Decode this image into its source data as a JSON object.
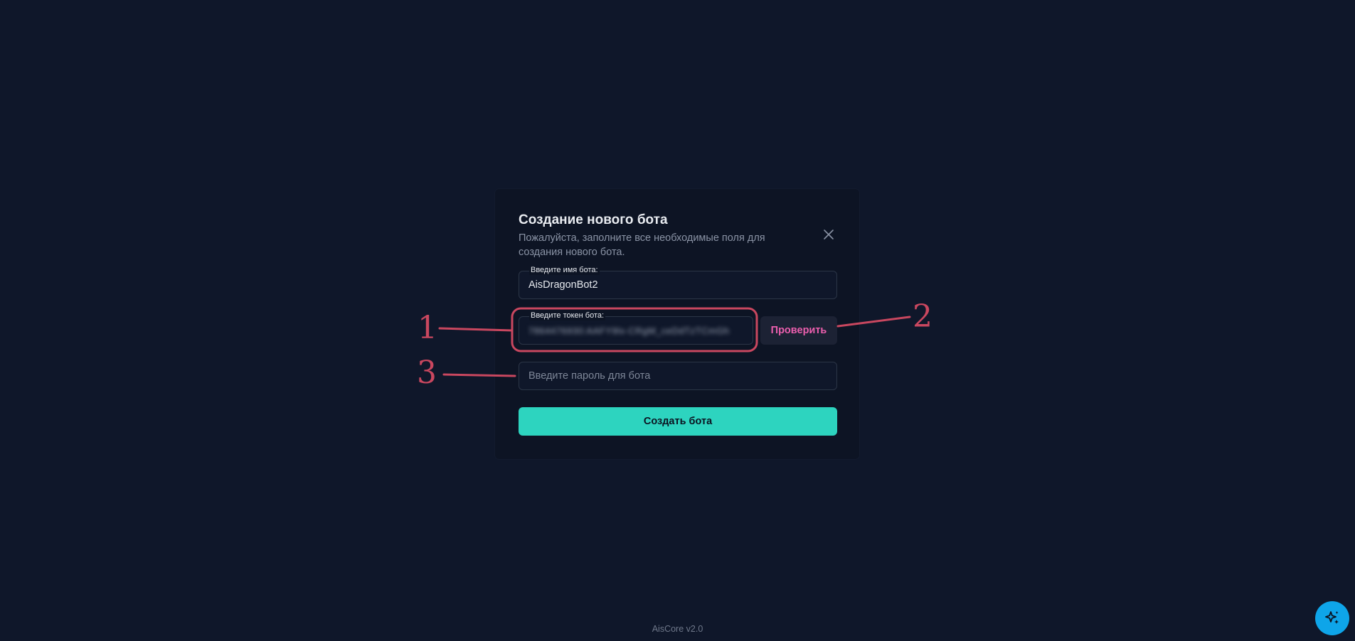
{
  "modal": {
    "title": "Создание нового бота",
    "description": "Пожалуйста, заполните все необходимые поля для создания нового бота.",
    "close_icon": "close-icon",
    "name_field": {
      "label": "Введите имя бота:",
      "value": "AisDragonBot2"
    },
    "token_field": {
      "label": "Введите токен бота:",
      "value": "7864476930:AAFY9lx-CRgM_ceDdTzTCmGh"
    },
    "check_button": {
      "label": "Проверить"
    },
    "password_field": {
      "placeholder": "Введите пароль для бота",
      "value": ""
    },
    "create_button": {
      "label": "Создать бота"
    }
  },
  "annotations": {
    "labels": [
      "1",
      "2",
      "3"
    ],
    "color": "#c9475f"
  },
  "footer": {
    "version": "AisCore v2.0"
  },
  "assistant_button": {
    "icon": "sparkles-icon",
    "color": "#0ea5e9"
  },
  "colors": {
    "background": "#0f172a",
    "modal_background": "#0d1424",
    "accent_teal": "#2dd4bf",
    "accent_pink": "#ec5fae"
  }
}
